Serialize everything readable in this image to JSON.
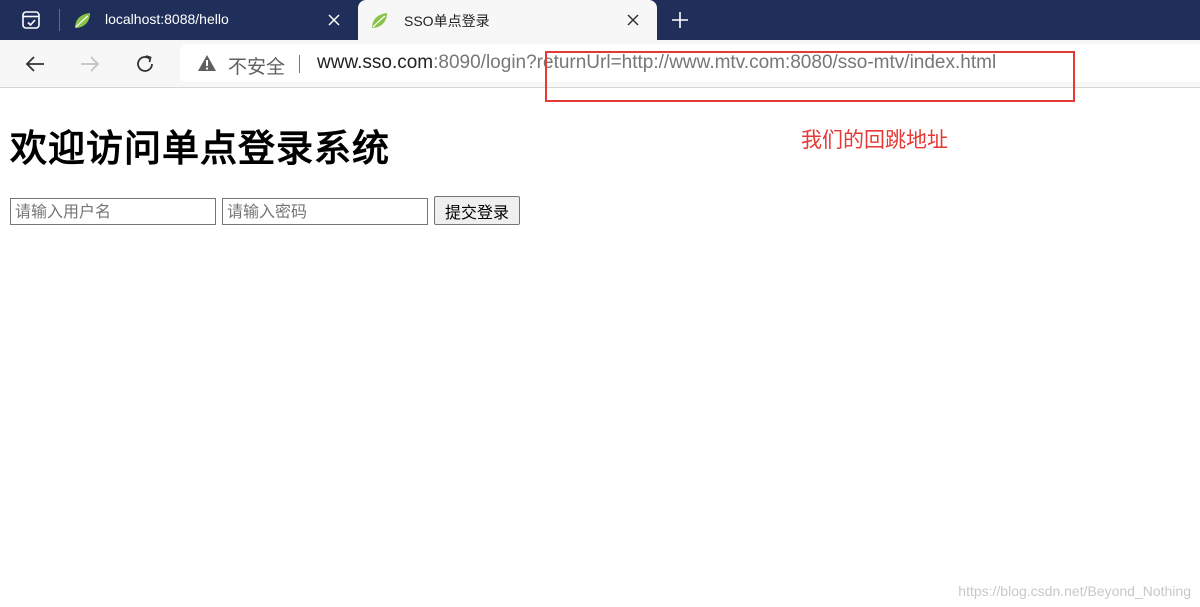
{
  "tabs": [
    {
      "title": "localhost:8088/hello",
      "active": false
    },
    {
      "title": "SSO单点登录",
      "active": true
    }
  ],
  "toolbar": {
    "security_label": "不安全",
    "url_host": "www.sso.com",
    "url_rest": ":8090/login?returnUrl=http://www.mtv.com:8080/sso-mtv/index.html"
  },
  "page": {
    "heading": "欢迎访问单点登录系统",
    "username_placeholder": "请输入用户名",
    "password_placeholder": "请输入密码",
    "submit_label": "提交登录"
  },
  "annotation": {
    "text": "我们的回跳地址",
    "color": "#e53935"
  },
  "watermark": "https://blog.csdn.net/Beyond_Nothing",
  "icons": {
    "tab_actions": "tab-actions-icon",
    "favicon": "spring-leaf-icon",
    "close": "close-icon",
    "new_tab": "plus-icon",
    "back": "back-arrow-icon",
    "forward": "forward-arrow-icon",
    "reload": "reload-icon",
    "warning": "warning-triangle-icon"
  }
}
